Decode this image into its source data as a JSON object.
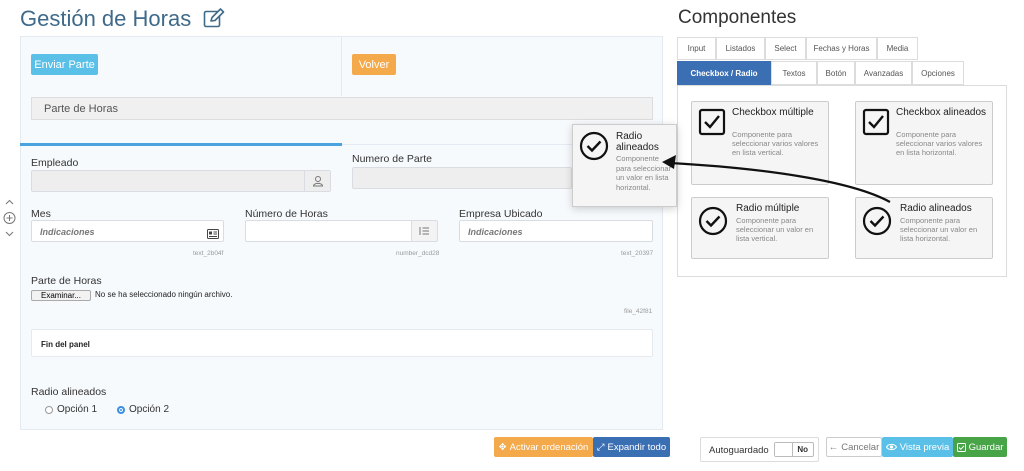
{
  "header": {
    "title": "Gestión de Horas",
    "edit_icon": "edit-icon"
  },
  "form": {
    "enviar_label": "Enviar Parte",
    "volver_label": "Volver",
    "section_title": "Parte de Horas",
    "empleado": {
      "label": "Empleado",
      "value": "",
      "icon": "user-icon"
    },
    "numero_parte": {
      "label": "Numero de Parte",
      "value": ""
    },
    "mes": {
      "label": "Mes",
      "placeholder": "Indicaciones",
      "id": "text_2b04f",
      "icon": "card-icon"
    },
    "numero_horas": {
      "label": "Número de Horas",
      "value": "",
      "id": "number_dcd28",
      "icon": "list-icon"
    },
    "empresa": {
      "label": "Empresa Ubicado",
      "placeholder": "Indicaciones",
      "id": "text_20397"
    },
    "file": {
      "label": "Parte de Horas",
      "button": "Examinar...",
      "status": "No se ha seleccionado ningún archivo.",
      "id": "file_42f81"
    },
    "panel_end": "Fin del panel",
    "radio": {
      "label": "Radio alineados",
      "options": [
        {
          "label": "Opción 1",
          "checked": false
        },
        {
          "label": "Opción 2",
          "checked": true
        }
      ]
    }
  },
  "side_control": {
    "up_icon": "chevron-up-icon",
    "add_icon": "plus-circle-icon",
    "down_icon": "chevron-down-icon"
  },
  "bottom_left": {
    "ordenar_label": "Activar ordenación",
    "expandir_label": "Expandir todo"
  },
  "components": {
    "title": "Componentes",
    "tabs_row1": [
      "Input",
      "Listados",
      "Select",
      "Fechas y Horas",
      "Media"
    ],
    "tabs_row2": [
      "Checkbox / Radio",
      "Textos",
      "Botón",
      "Avanzadas",
      "Opciones"
    ],
    "active_tab": "Checkbox / Radio",
    "cards": [
      {
        "title": "Checkbox múltiple",
        "desc": "Componente para seleccionar varios valores en lista vertical."
      },
      {
        "title": "Checkbox alineados",
        "desc": "Componente para seleccionar varios valores en lista horizontal."
      },
      {
        "title": "Radio múltiple",
        "desc": "Componente para seleccionar un valor en lista vertical."
      },
      {
        "title": "Radio alineados",
        "desc": "Componente para seleccionar un valor en lista horizontal."
      }
    ],
    "dragging": {
      "title": "Radio alineados",
      "desc": "Componente para seleccionar un valor en lista horizontal."
    }
  },
  "footer": {
    "autosave_label": "Autoguardado",
    "autosave_value": "No",
    "cancelar_label": "Cancelar",
    "vista_label": "Vista previa",
    "guardar_label": "Guardar"
  },
  "colors": {
    "accent": "#3b6fb4",
    "info": "#5bc0e8",
    "warning": "#f4a94a",
    "success": "#47a447",
    "title": "#3f6a8a"
  }
}
